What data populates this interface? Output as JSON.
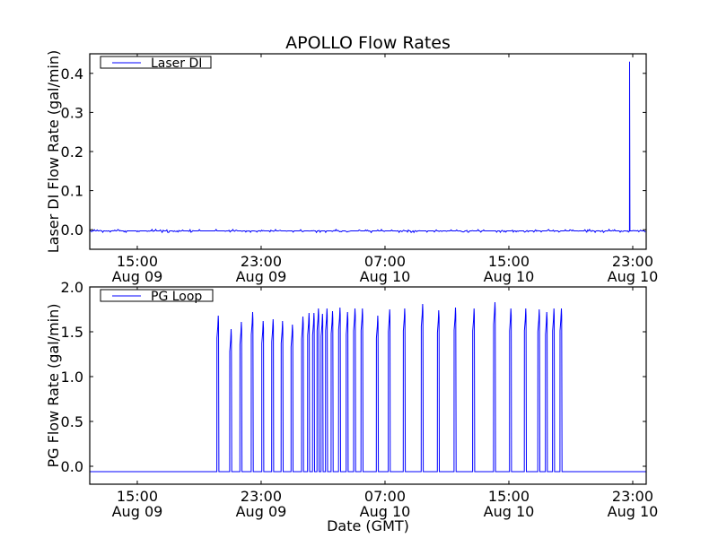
{
  "chart_data": [
    {
      "type": "line",
      "title": "APOLLO Flow Rates",
      "xlabel": "",
      "ylabel": "Laser DI Flow Rate (gal/min)",
      "legend": {
        "entries": [
          "Laser DI"
        ],
        "placement": "top-left"
      },
      "x_units": "hours since Aug 09 00:00 GMT",
      "xlim": [
        11.93,
        47.87
      ],
      "ylim": [
        -0.05,
        0.45
      ],
      "xticks": [
        {
          "value": 15,
          "label": [
            "15:00",
            "Aug 09"
          ]
        },
        {
          "value": 23,
          "label": [
            "23:00",
            "Aug 09"
          ]
        },
        {
          "value": 31,
          "label": [
            "07:00",
            "Aug 10"
          ]
        },
        {
          "value": 39,
          "label": [
            "15:00",
            "Aug 10"
          ]
        },
        {
          "value": 47,
          "label": [
            "23:00",
            "Aug 10"
          ]
        }
      ],
      "yticks": [
        {
          "value": 0.0,
          "label": "0.0"
        },
        {
          "value": 0.1,
          "label": "0.1"
        },
        {
          "value": 0.2,
          "label": "0.2"
        },
        {
          "value": 0.3,
          "label": "0.3"
        },
        {
          "value": 0.4,
          "label": "0.4"
        }
      ],
      "series": [
        {
          "name": "Laser DI",
          "color": "#0000ff",
          "baseline": -0.003,
          "noise_amplitude": 0.004,
          "spike": {
            "x": 46.8,
            "y": 0.43
          }
        }
      ]
    },
    {
      "type": "line",
      "title": "",
      "xlabel": "Date (GMT)",
      "ylabel": "PG Flow Rate (gal/min)",
      "legend": {
        "entries": [
          "PG Loop"
        ],
        "placement": "top-left"
      },
      "x_units": "hours since Aug 09 00:00 GMT",
      "xlim": [
        11.93,
        47.87
      ],
      "ylim": [
        -0.2,
        2.0
      ],
      "xticks": [
        {
          "value": 15,
          "label": [
            "15:00",
            "Aug 09"
          ]
        },
        {
          "value": 23,
          "label": [
            "23:00",
            "Aug 09"
          ]
        },
        {
          "value": 31,
          "label": [
            "07:00",
            "Aug 10"
          ]
        },
        {
          "value": 39,
          "label": [
            "15:00",
            "Aug 10"
          ]
        },
        {
          "value": 47,
          "label": [
            "23:00",
            "Aug 10"
          ]
        }
      ],
      "yticks": [
        {
          "value": 0.0,
          "label": "0.0"
        },
        {
          "value": 0.5,
          "label": "0.5"
        },
        {
          "value": 1.0,
          "label": "1.0"
        },
        {
          "value": 1.5,
          "label": "1.5"
        },
        {
          "value": 2.0,
          "label": "2.0"
        }
      ],
      "series": [
        {
          "name": "PG Loop",
          "color": "#0000ff",
          "baseline": -0.06,
          "pulses": [
            [
              20.14,
              1.68
            ],
            [
              20.97,
              1.53
            ],
            [
              21.63,
              1.61
            ],
            [
              22.36,
              1.72
            ],
            [
              23.04,
              1.62
            ],
            [
              23.68,
              1.64
            ],
            [
              24.29,
              1.62
            ],
            [
              24.93,
              1.58
            ],
            [
              25.61,
              1.67
            ],
            [
              26.0,
              1.71
            ],
            [
              26.32,
              1.71
            ],
            [
              26.61,
              1.76
            ],
            [
              26.87,
              1.7
            ],
            [
              27.16,
              1.76
            ],
            [
              27.52,
              1.73
            ],
            [
              28.0,
              1.77
            ],
            [
              28.49,
              1.72
            ],
            [
              28.97,
              1.76
            ],
            [
              29.45,
              1.76
            ],
            [
              30.44,
              1.68
            ],
            [
              31.21,
              1.75
            ],
            [
              32.18,
              1.76
            ],
            [
              33.34,
              1.81
            ],
            [
              34.38,
              1.74
            ],
            [
              35.46,
              1.77
            ],
            [
              36.66,
              1.76
            ],
            [
              38.01,
              1.83
            ],
            [
              39.04,
              1.76
            ],
            [
              40.0,
              1.76
            ],
            [
              40.87,
              1.75
            ],
            [
              41.36,
              1.72
            ],
            [
              41.82,
              1.76
            ],
            [
              42.3,
              1.76
            ]
          ]
        }
      ]
    }
  ]
}
